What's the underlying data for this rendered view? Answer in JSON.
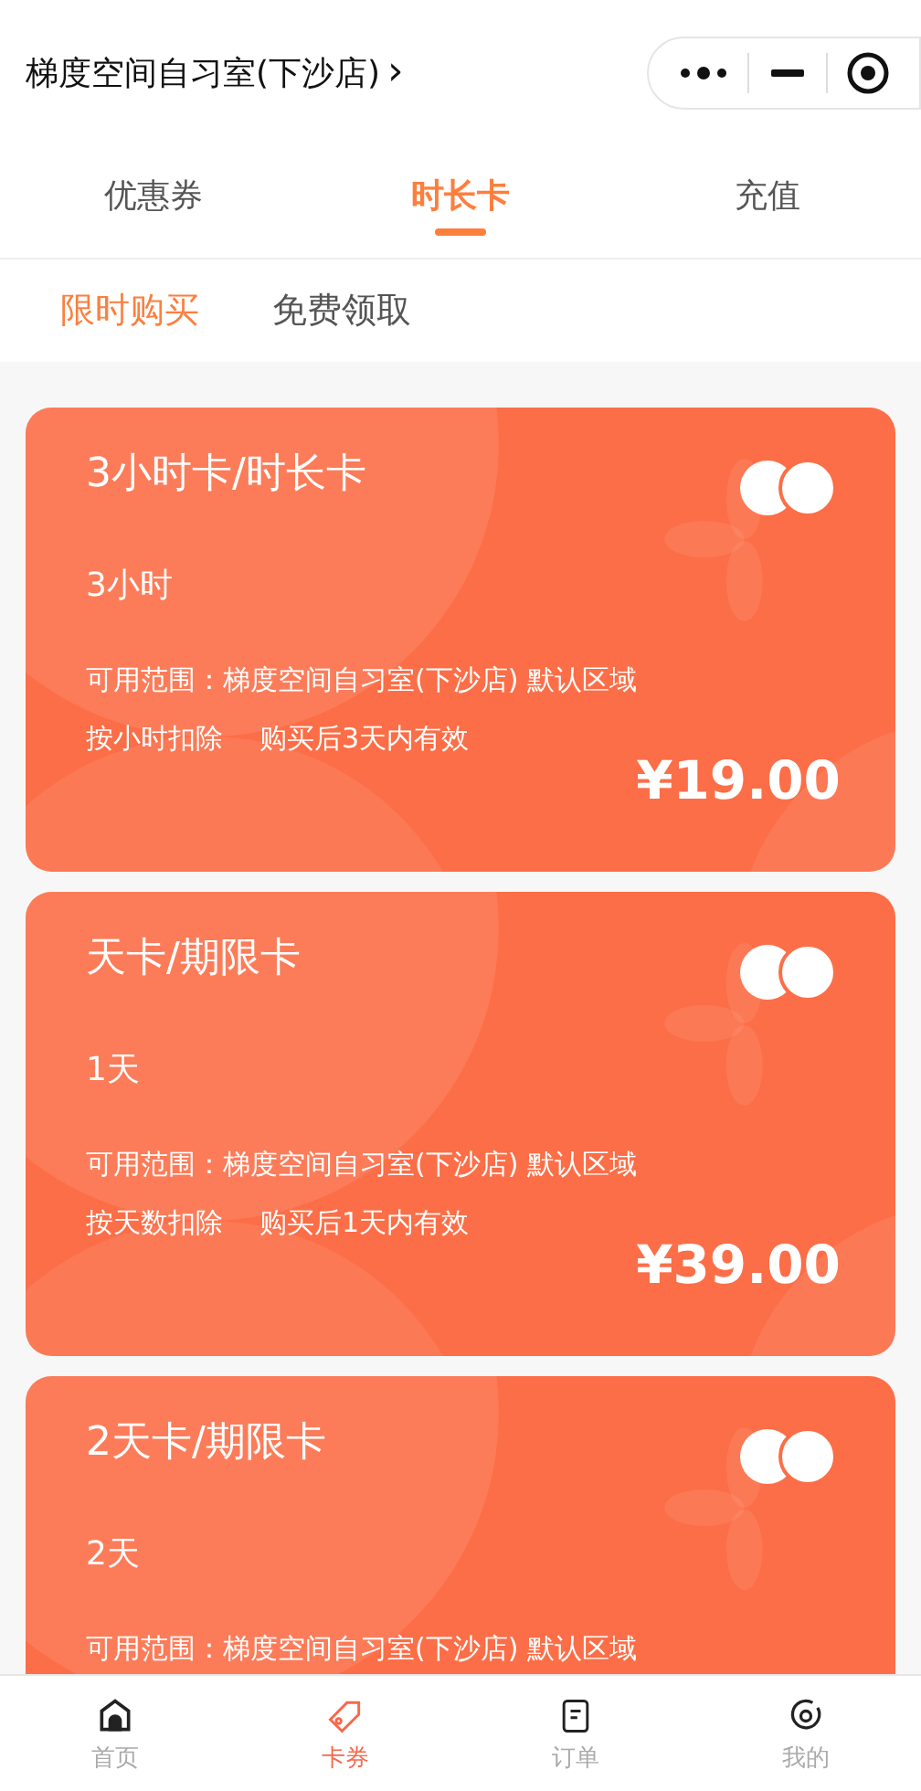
{
  "header": {
    "title": "梯度空间自习室(下沙店)",
    "chevron": "›"
  },
  "tabs": [
    {
      "label": "优惠券",
      "selected": false
    },
    {
      "label": "时长卡",
      "selected": true
    },
    {
      "label": "充值",
      "selected": false
    }
  ],
  "subtabs": [
    {
      "label": "限时购买",
      "selected": true
    },
    {
      "label": "免费领取",
      "selected": false
    }
  ],
  "cards": [
    {
      "title": "3小时卡/时长卡",
      "amount": "3小时",
      "scope": "可用范围：梯度空间自习室(下沙店) 默认区域",
      "deduction": "按小时扣除",
      "validity": "购买后3天内有效",
      "price": "¥19.00"
    },
    {
      "title": "天卡/期限卡",
      "amount": "1天",
      "scope": "可用范围：梯度空间自习室(下沙店) 默认区域",
      "deduction": "按天数扣除",
      "validity": "购买后1天内有效",
      "price": "¥39.00"
    },
    {
      "title": "2天卡/期限卡",
      "amount": "2天",
      "scope": "可用范围：梯度空间自习室(下沙店) 默认区域"
    }
  ],
  "tabbar": [
    {
      "label": "首页",
      "kind": "home",
      "selected": false
    },
    {
      "label": "卡券",
      "kind": "tag",
      "selected": true
    },
    {
      "label": "订单",
      "kind": "order",
      "selected": false
    },
    {
      "label": "我的",
      "kind": "profile",
      "selected": false
    }
  ]
}
